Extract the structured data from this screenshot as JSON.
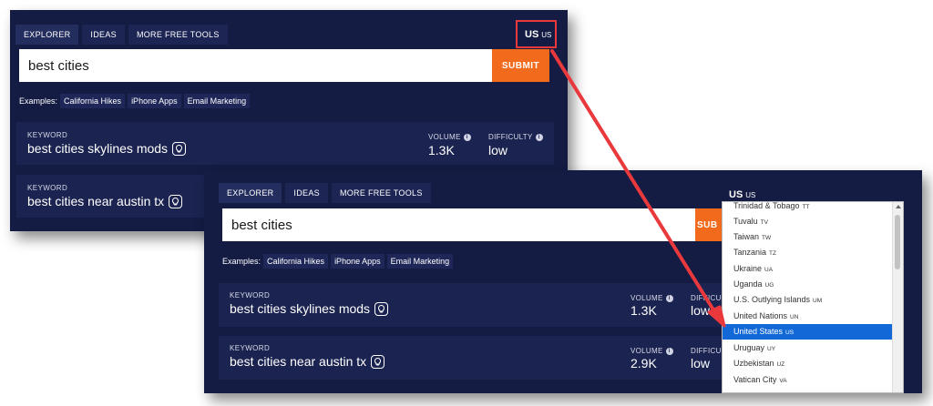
{
  "tabs": [
    {
      "label": "EXPLORER",
      "active": true
    },
    {
      "label": "IDEAS",
      "active": false
    },
    {
      "label": "MORE FREE TOOLS",
      "active": false
    }
  ],
  "country": {
    "code": "US",
    "code_small": "US"
  },
  "search": {
    "value": "best cities",
    "submit_label": "SUBMIT",
    "submit_label_clipped": "SUB"
  },
  "examples": {
    "label": "Examples:",
    "items": [
      "California Hikes",
      "iPhone Apps",
      "Email Marketing"
    ]
  },
  "result_headers": {
    "keyword": "KEYWORD",
    "volume": "VOLUME",
    "difficulty": "DIFFICULTY",
    "difficulty_clipped": "DIFFICU"
  },
  "results": [
    {
      "keyword": "best cities skylines mods",
      "volume": "1.3K",
      "difficulty": "low"
    },
    {
      "keyword": "best cities near austin tx",
      "volume": "2.9K",
      "difficulty": "low"
    }
  ],
  "dropdown": {
    "items": [
      {
        "name": "Trinidad & Tobago",
        "code": "TT"
      },
      {
        "name": "Tuvalu",
        "code": "TV"
      },
      {
        "name": "Taiwan",
        "code": "TW"
      },
      {
        "name": "Tanzania",
        "code": "TZ"
      },
      {
        "name": "Ukraine",
        "code": "UA"
      },
      {
        "name": "Uganda",
        "code": "UG"
      },
      {
        "name": "U.S. Outlying Islands",
        "code": "UM"
      },
      {
        "name": "United Nations",
        "code": "UN"
      },
      {
        "name": "United States",
        "code": "US",
        "selected": true
      },
      {
        "name": "Uruguay",
        "code": "UY"
      },
      {
        "name": "Uzbekistan",
        "code": "UZ"
      },
      {
        "name": "Vatican City",
        "code": "VA"
      }
    ]
  },
  "colors": {
    "panel_bg": "#141c44",
    "card_bg": "#1b2350",
    "submit_orange": "#f26a1b",
    "annotation_red": "#e9393d",
    "selected_blue": "#1268d6"
  }
}
